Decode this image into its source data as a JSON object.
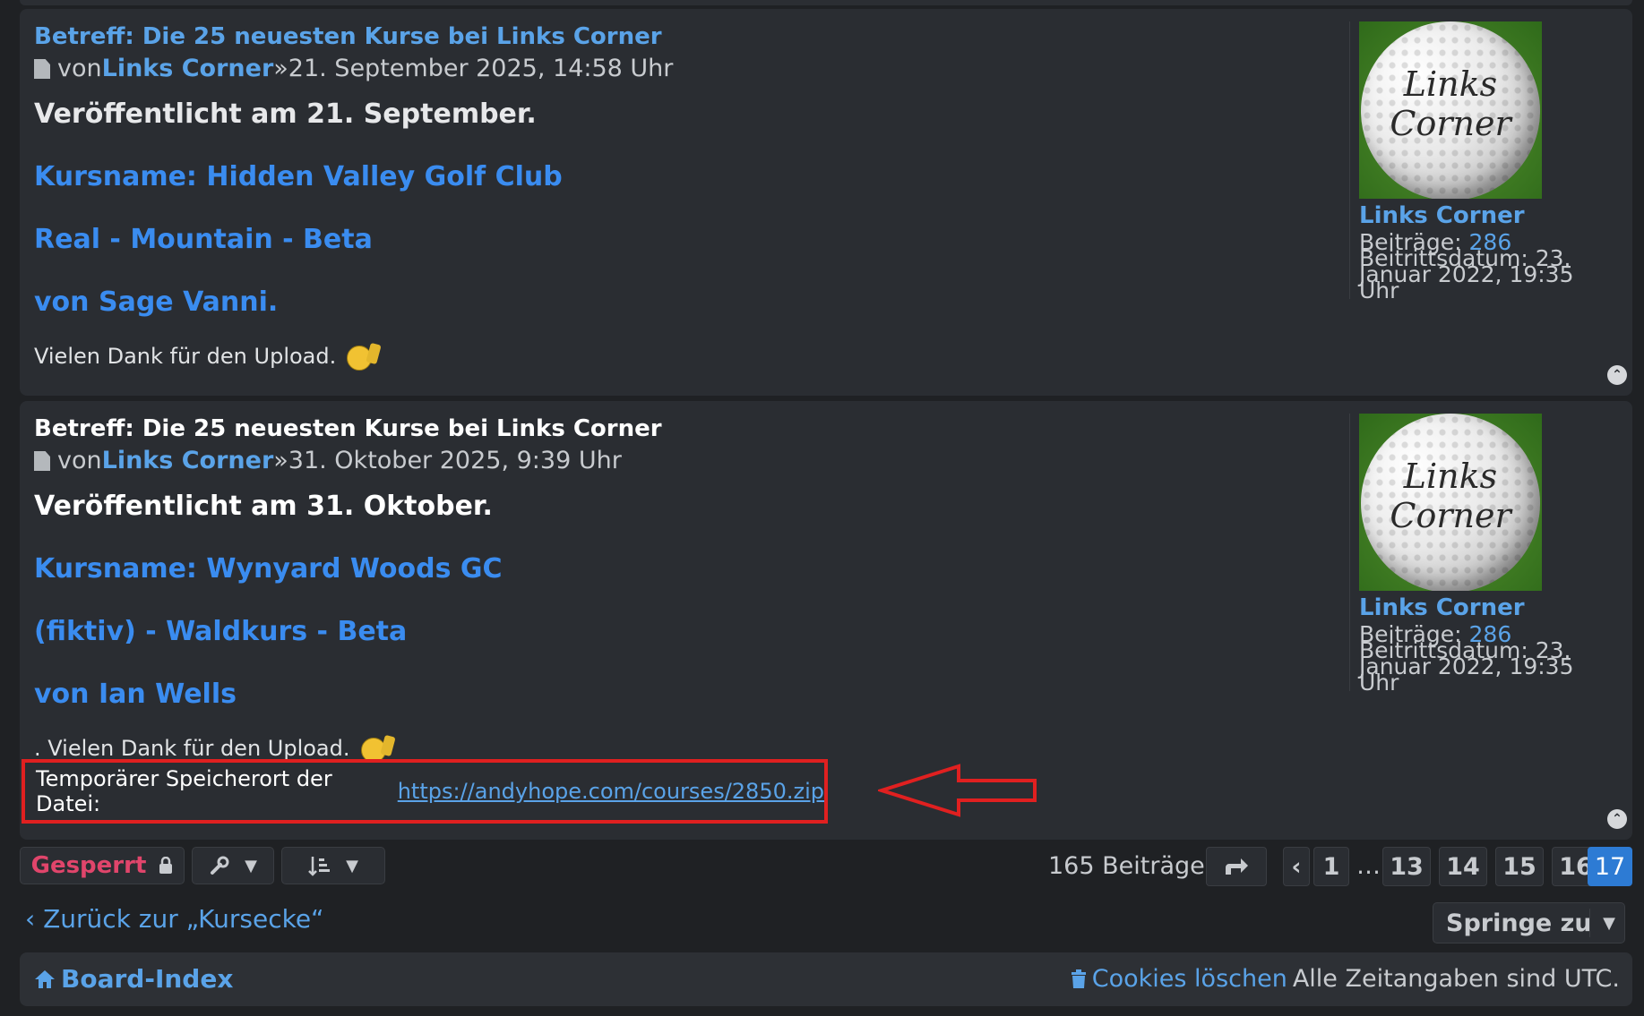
{
  "posts": [
    {
      "subject": "Betreff: Die 25 neuesten Kurse bei Links Corner",
      "by": "von",
      "author": "Links Corner",
      "date": "»21. September 2025, 14:58 Uhr",
      "lead": "Veröffentlicht am 21. September.",
      "course": "Kursname: Hidden Valley Golf Club",
      "type": "Real - Mountain - Beta",
      "creator": "von Sage Vanni.",
      "thanks": "Vielen Dank für den Upload."
    },
    {
      "subject": "Betreff: Die 25 neuesten Kurse bei Links Corner",
      "by": "von",
      "author": "Links Corner",
      "date": "»31. Oktober 2025, 9:39 Uhr",
      "lead": "Veröffentlicht am 31. Oktober.",
      "course": "Kursname: Wynyard Woods GC",
      "type": "(fiktiv) - Waldkurs - Beta",
      "creator": "von Ian Wells",
      "thanks": ". Vielen Dank für den Upload.",
      "temp_label": "Temporärer Speicherort der Datei:",
      "temp_url": "https://andyhope.com/courses/2850.zip"
    }
  ],
  "profile": {
    "avatar_line1": "Links",
    "avatar_line2": "Corner",
    "username": "Links Corner",
    "posts_label": "Beiträge:",
    "posts_count": "286",
    "joined_label": "Beitrittsdatum:",
    "joined_value": "23. Januar 2022, 19:35 Uhr"
  },
  "actions": {
    "locked_label": "Gesperrt",
    "total": "165 Beiträge",
    "pages": [
      "1",
      "13",
      "14",
      "15",
      "16",
      "17"
    ],
    "ellipsis": "…",
    "current_page": "17"
  },
  "nav": {
    "back": "Zurück zur „Kursecke“",
    "jump": "Springe zu"
  },
  "footer": {
    "home": "Board-Index",
    "cookies": "Cookies löschen",
    "timezone": "Alle Zeitangaben sind UTC."
  },
  "colors": {
    "background": "#1f2124",
    "panel": "#2a2d32",
    "link": "#5aa3e8",
    "bold_link": "#3a8cf0",
    "locked": "#e0456b",
    "active_page": "#2d7bd4",
    "highlight": "#e02020"
  }
}
